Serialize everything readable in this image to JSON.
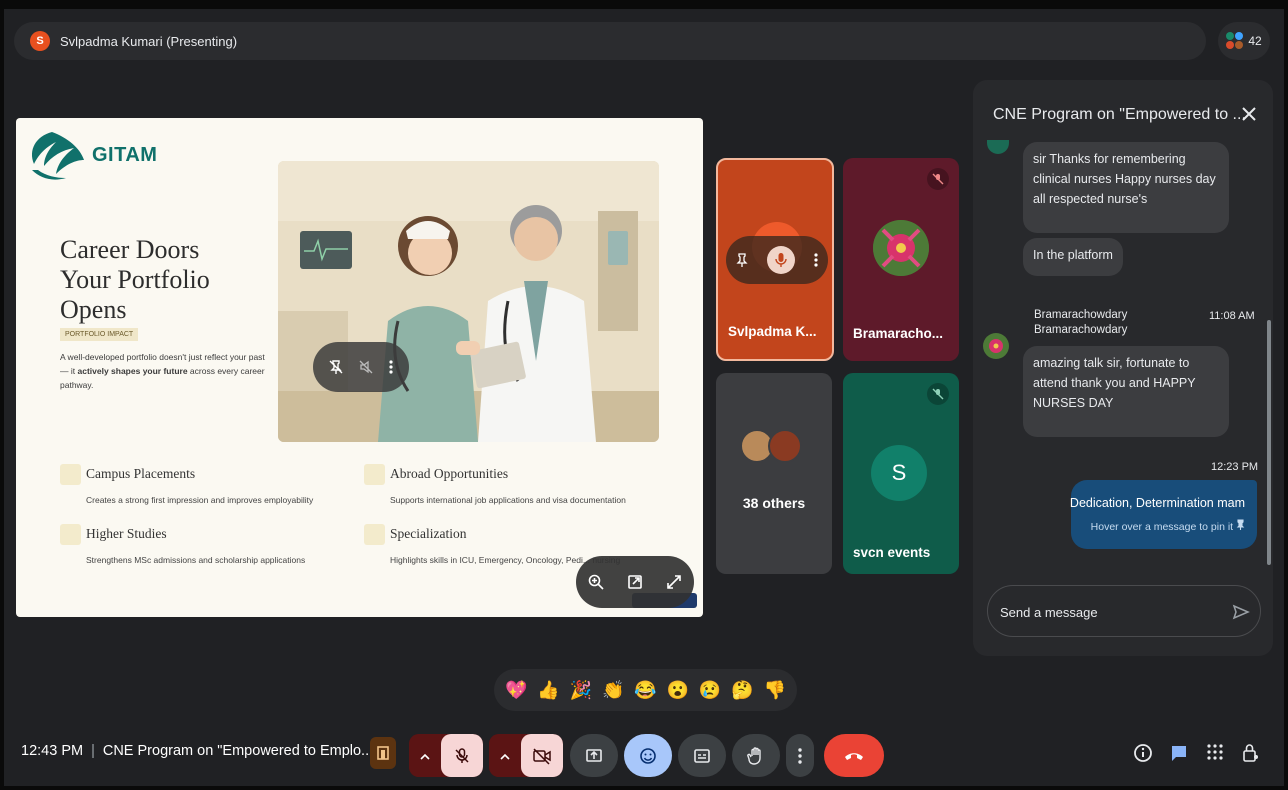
{
  "topbar": {
    "presenter_initial": "S",
    "presenter_label": "Svlpadma Kumari (Presenting)",
    "participant_count": "42"
  },
  "slide": {
    "logo_text": "GITAM",
    "tag": "PORTFOLIO IMPACT",
    "heading_lines": [
      "Career Doors",
      "Your Portfolio",
      "Opens"
    ],
    "desc_pre": "A well-developed portfolio doesn't just reflect your past — it ",
    "desc_bold": "actively shapes your future",
    "desc_post": " across every career pathway.",
    "features": [
      {
        "title": "Campus Placements",
        "desc": "Creates a strong first impression and improves employability"
      },
      {
        "title": "Abroad Opportunities",
        "desc": "Supports international job applications and visa documentation"
      },
      {
        "title": "Higher Studies",
        "desc": "Strengthens MSc admissions and scholarship applications"
      },
      {
        "title": "Specialization",
        "desc": "Highlights skills in ICU, Emergency, Oncology, Pedi... nursing"
      }
    ]
  },
  "tiles": [
    {
      "name": "Svlpadma K...",
      "color": "#c2451c"
    },
    {
      "name": "Bramaracho...",
      "color": "#5e1a2a"
    },
    {
      "name": "38 others",
      "color": "#3c3d40"
    },
    {
      "name": "svcn events",
      "color": "#0f5c4a",
      "initial": "S"
    }
  ],
  "chat": {
    "title": "CNE Program on \"Empowered to ...",
    "messages": [
      {
        "text": "sir Thanks for remembering clinical nurses Happy nurses day all respected nurse's"
      },
      {
        "text": "In the platform"
      },
      {
        "sender_line1": "Bramarachowdary",
        "sender_line2": "Bramarachowdary",
        "time": "11:08 AM",
        "text": "amazing talk sir, fortunate to attend thank you and HAPPY NURSES DAY"
      }
    ],
    "mine": {
      "time": "12:23 PM",
      "text": "Dedication, Determination mam",
      "hint": "Hover over a message to pin it"
    },
    "input_placeholder": "Send a message"
  },
  "reactions": [
    "💖",
    "👍",
    "🎉",
    "👏",
    "😂",
    "😮",
    "😢",
    "🤔",
    "👎"
  ],
  "bottom": {
    "time": "12:43 PM",
    "separator": "|",
    "meeting_title": "CNE Program on \"Empowered to Emplo..."
  }
}
